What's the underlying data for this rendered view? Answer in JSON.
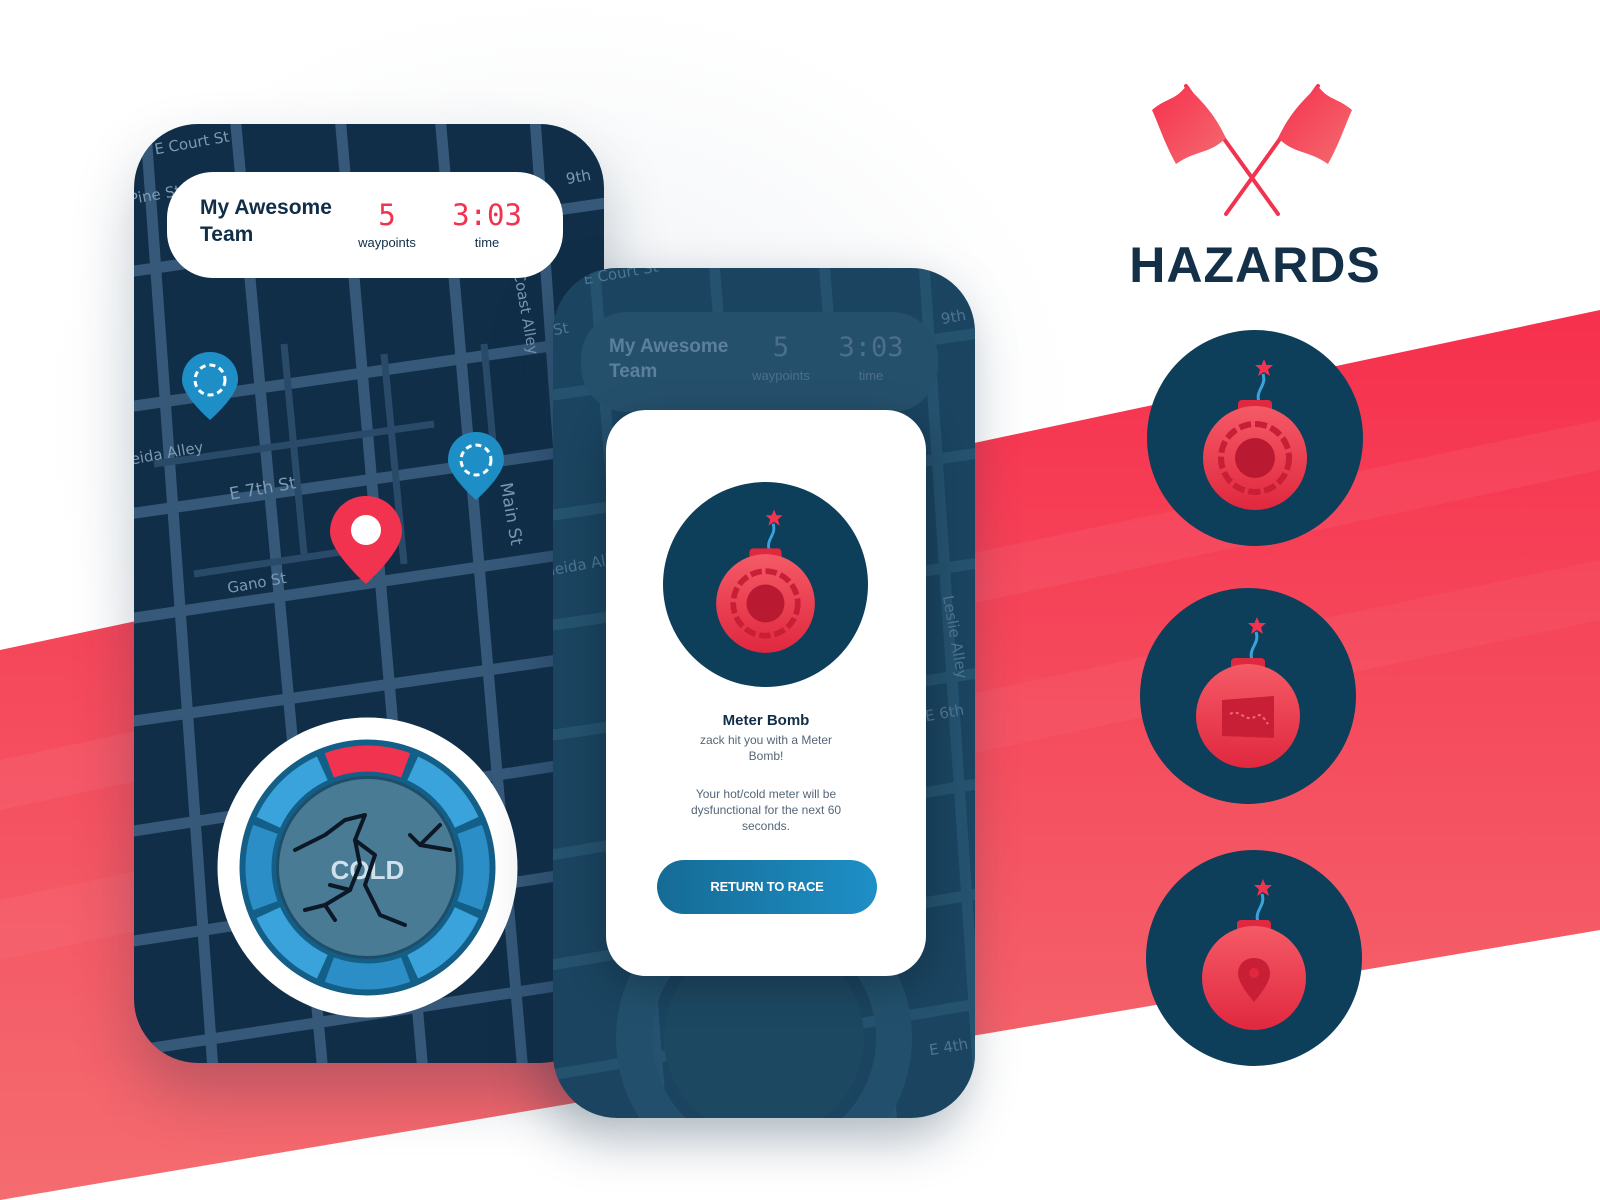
{
  "header": {
    "team_name": "My Awesome Team",
    "waypoints_value": "5",
    "waypoints_label": "waypoints",
    "time_value": "3:03",
    "time_label": "time"
  },
  "map": {
    "streets": [
      "E Court St",
      "Pine St",
      "9th",
      "Oneida Alley",
      "E 7th St",
      "Main St",
      "Gano St",
      "Coast Alley",
      "St",
      "Leslie Alley",
      "E 6th",
      "E 4th"
    ]
  },
  "meter": {
    "label": "COLD",
    "state": "broken"
  },
  "modal": {
    "title": "Meter Bomb",
    "subtitle": "zack hit you with a Meter Bomb!",
    "body": "Your hot/cold meter will be dysfunctional for the next 60 seconds.",
    "button_label": "RETURN TO RACE"
  },
  "hazards": {
    "title": "HAZARDS",
    "icons": [
      "meter-bomb-icon",
      "map-bomb-icon",
      "location-bomb-icon"
    ]
  },
  "colors": {
    "navy": "#112e48",
    "accent_red": "#f1334f",
    "blue": "#1e8fc6",
    "icon_circle": "#0d3e5a"
  }
}
